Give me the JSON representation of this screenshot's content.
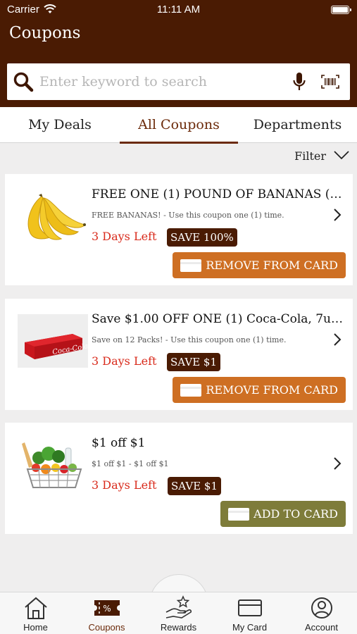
{
  "status_bar": {
    "carrier": "Carrier",
    "time": "11:11 AM"
  },
  "header": {
    "title": "Coupons"
  },
  "search": {
    "placeholder": "Enter keyword to search"
  },
  "tabs": [
    {
      "label": "My Deals"
    },
    {
      "label": "All Coupons",
      "active": true
    },
    {
      "label": "Departments"
    }
  ],
  "filter": {
    "label": "Filter"
  },
  "coupons": [
    {
      "title": "FREE ONE (1) POUND OF BANANAS (US...",
      "description": "FREE BANANAS! - Use this coupon one (1) time.",
      "days_left": "3 Days Left",
      "save": "SAVE 100%",
      "button": "REMOVE FROM CARD",
      "image": "bananas"
    },
    {
      "title": "Save $1.00 OFF ONE (1) Coca-Cola, 7up, o...",
      "description": "Save on 12 Packs! - Use this coupon one (1) time.",
      "days_left": "3 Days Left",
      "save": "SAVE $1",
      "button": "REMOVE FROM CARD",
      "image": "coca-cola-12-pack",
      "brand_text": "Coca-Cola"
    },
    {
      "title": "$1 off $1",
      "description": "$1 off $1 - $1 off $1",
      "days_left": "3 Days Left",
      "save": "SAVE $1",
      "button": "ADD TO CARD",
      "image": "grocery-basket"
    }
  ],
  "bottom_nav": [
    {
      "label": "Home",
      "icon": "home-icon"
    },
    {
      "label": "Coupons",
      "icon": "coupon-ticket-icon",
      "active": true
    },
    {
      "label": "Rewards",
      "icon": "rewards-hand-star-icon"
    },
    {
      "label": "My Card",
      "icon": "card-icon"
    },
    {
      "label": "Account",
      "icon": "account-icon"
    }
  ],
  "colors": {
    "header_bg": "#4a1b03",
    "accent_brown": "#6b2a0a",
    "days_left_red": "#d92b1c",
    "remove_button": "#ce6f23",
    "add_button": "#7e7c3a"
  }
}
